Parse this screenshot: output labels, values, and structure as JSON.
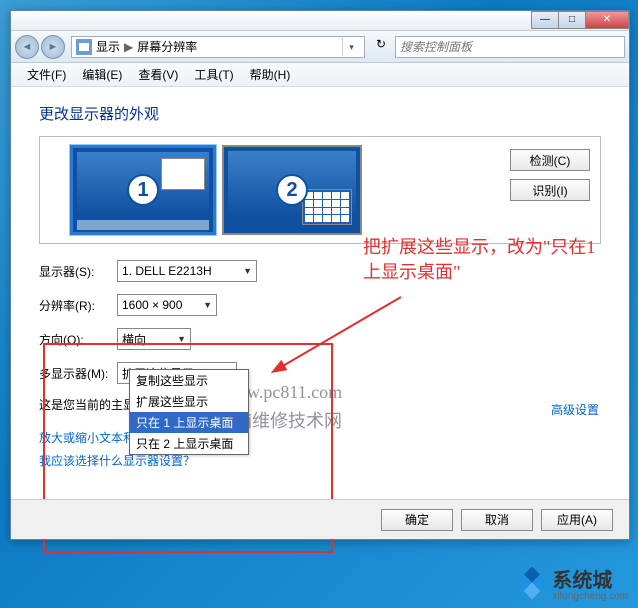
{
  "nav": {
    "crumb1": "显示",
    "crumb2": "屏幕分辨率",
    "search_placeholder": "搜索控制面板"
  },
  "menu": {
    "file": "文件(F)",
    "edit": "编辑(E)",
    "view": "查看(V)",
    "tools": "工具(T)",
    "help": "帮助(H)"
  },
  "heading": "更改显示器的外观",
  "monitor_area": {
    "num1": "1",
    "num2": "2",
    "detect": "检测(C)",
    "identify": "识别(I)"
  },
  "form": {
    "display_label": "显示器(S):",
    "display_value": "1. DELL E2213H",
    "resolution_label": "分辨率(R):",
    "resolution_value": "1600 × 900",
    "orientation_label": "方向(O):",
    "orientation_value": "横向",
    "multi_label": "多显示器(M):",
    "multi_value": "扩展这些显示"
  },
  "dropdown_multi": {
    "opt1": "复制这些显示",
    "opt2": "扩展这些显示",
    "opt3": "只在 1 上显示桌面",
    "opt4": "只在 2 上显示桌面"
  },
  "current_text": "这是您当前的主显示器。",
  "adv_link": "高级设置",
  "link1": "放大或缩小文本和其他项目",
  "link2": "我应该选择什么显示器设置？",
  "buttons": {
    "ok": "确定",
    "cancel": "取消",
    "apply": "应用(A)"
  },
  "annotation": "把扩展这些显示，改为\"只在1上显示桌面\"",
  "watermark": {
    "line1": "www.pc811.com",
    "line2": "电脑维修技术网"
  },
  "brand": {
    "name": "系统城",
    "sub": "xitongcheng.com"
  }
}
